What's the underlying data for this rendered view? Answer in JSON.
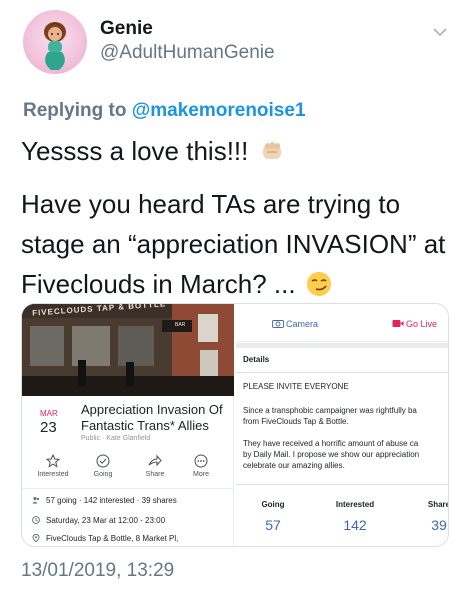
{
  "tweet": {
    "display_name": "Genie",
    "handle": "@AdultHumanGenie",
    "replying_prefix": "Replying to",
    "replying_mention": "@makemorenoise1",
    "line1": "Yessss a love this!!!",
    "line2": "Have you heard TAs are trying to stage an “appreciation INVASION” at Fiveclouds in March? ...",
    "timestamp": "13/01/2019, 13:29"
  },
  "event_card": {
    "sign_text": "FIVECLOUDS TAP & BOTTLE",
    "bar_sign": "BAR",
    "month": "MAR",
    "day": "23",
    "title": "Appreciation Invasion Of Fantastic Trans* Allies",
    "meta": "Public · Kate Glanfield",
    "actions": [
      {
        "label": "Interested",
        "icon": "star-icon"
      },
      {
        "label": "Going",
        "icon": "check-circle-icon"
      },
      {
        "label": "Share",
        "icon": "share-icon"
      },
      {
        "label": "More",
        "icon": "more-icon"
      }
    ],
    "stats_line": "57 going · 142 interested · 39 shares",
    "datetime_line": "Saturday, 23 Mar at 12:00 - 23:00",
    "location_line": "FiveClouds Tap & Bottle, 8 Market Pl,"
  },
  "event_details": {
    "camera_label": "Camera",
    "live_label": "Go Live",
    "heading": "Details",
    "invite_line": "PLEASE INVITE EVERYONE",
    "para1": [
      "Since a transphobic campaigner was rightfully ba",
      "from FiveClouds Tap & Bottle."
    ],
    "para2": [
      "They have received a horrific amount of abuse ca",
      "by Daily Mail. I propose we show our appreciation",
      "celebrate our amazing allies."
    ],
    "stats": [
      {
        "label": "Going",
        "value": "57"
      },
      {
        "label": "Interested",
        "value": "142"
      },
      {
        "label": "Share",
        "value": "39"
      }
    ]
  },
  "colors": {
    "link_blue": "#1b95e0",
    "fb_blue": "#4267b2",
    "muted": "#657786",
    "accent_red": "#e0245e"
  }
}
